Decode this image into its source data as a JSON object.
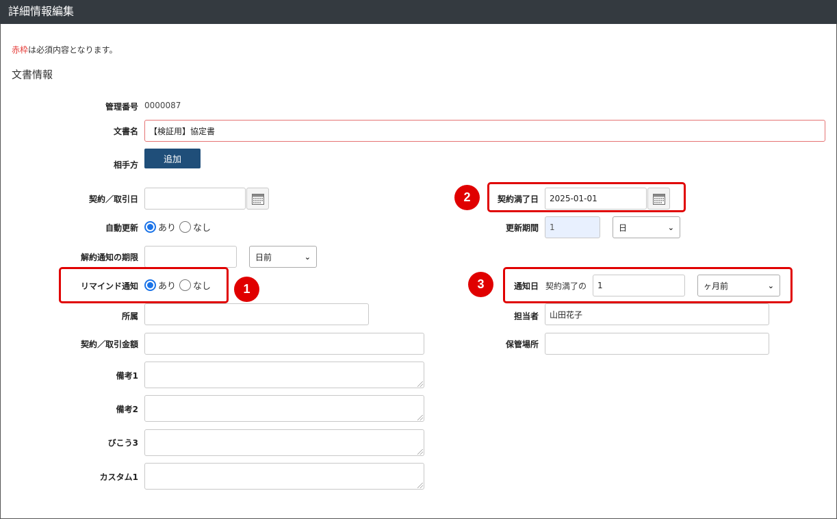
{
  "window": {
    "title": "詳細情報編集"
  },
  "note": {
    "required_red": "赤枠",
    "required_rest": "は必須内容となります。"
  },
  "section_title": "文書情報",
  "labels": {
    "mgmt_no": "管理番号",
    "doc_name": "文書名",
    "counterparty": "相手方",
    "contract_date": "契約／取引日",
    "contract_end": "契約満了日",
    "auto_renew": "自動更新",
    "renew_period": "更新期間",
    "cancel_deadline": "解約通知の期限",
    "remind": "リマインド通知",
    "notify_day": "通知日",
    "dept": "所属",
    "owner": "担当者",
    "amount": "契約／取引金額",
    "storage": "保管場所",
    "memo1": "備考1",
    "memo2": "備考2",
    "memo3": "びこう3",
    "custom1": "カスタム1"
  },
  "values": {
    "mgmt_no": "0000087",
    "doc_name": "【検証用】協定書",
    "contract_end": "2025-01-01",
    "renew_period": "1",
    "notify_prefix": "契約満了の",
    "notify_value": "1",
    "owner": "山田花子"
  },
  "buttons": {
    "add": "追加"
  },
  "radio": {
    "yes": "あり",
    "no": "なし"
  },
  "selects": {
    "renew_unit": "日",
    "cancel_unit": "日前",
    "notify_unit": "ヶ月前"
  },
  "badges": [
    "1",
    "2",
    "3"
  ],
  "colors": {
    "titlebar": "#343a40",
    "highlight": "#e00000",
    "primary": "#1f4e79",
    "radio": "#1a73e8"
  }
}
